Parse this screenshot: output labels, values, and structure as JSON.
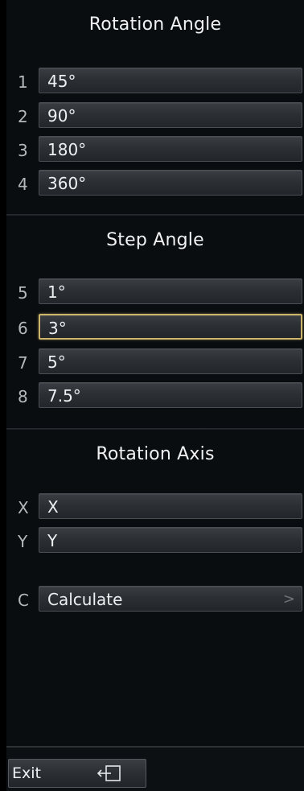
{
  "rotation_angle": {
    "title": "Rotation Angle",
    "items": [
      {
        "key": "1",
        "label": "45°"
      },
      {
        "key": "2",
        "label": "90°"
      },
      {
        "key": "3",
        "label": "180°"
      },
      {
        "key": "4",
        "label": "360°"
      }
    ]
  },
  "step_angle": {
    "title": "Step Angle",
    "items": [
      {
        "key": "5",
        "label": "1°"
      },
      {
        "key": "6",
        "label": "3°",
        "selected": true
      },
      {
        "key": "7",
        "label": "5°"
      },
      {
        "key": "8",
        "label": "7.5°"
      }
    ]
  },
  "rotation_axis": {
    "title": "Rotation Axis",
    "items": [
      {
        "key": "X",
        "label": "X"
      },
      {
        "key": "Y",
        "label": "Y"
      }
    ],
    "calculate": {
      "key": "C",
      "label": "Calculate",
      "chevron": ">"
    }
  },
  "footer": {
    "exit_label": "Exit",
    "exit_icon": "exit-door-icon"
  },
  "colors": {
    "background": "#0a0d10",
    "button_border": "#4a4f55",
    "selected_border": "#cdb56a"
  }
}
